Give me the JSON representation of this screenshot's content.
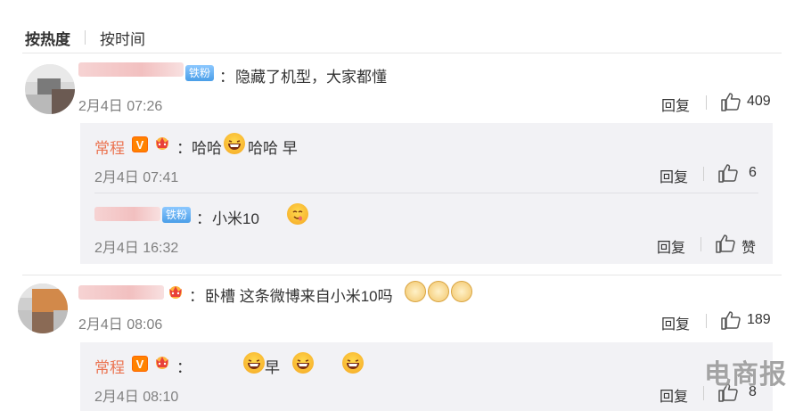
{
  "sort": {
    "hot": "按热度",
    "time": "按时间"
  },
  "badges": {
    "fan": "铁粉",
    "vip": "V"
  },
  "watermark": "电商报",
  "comments": [
    {
      "colon": "：",
      "text": "隐藏了机型，大家都懂",
      "time": "2月4日 07:26",
      "reply_label": "回复",
      "likes": "409",
      "replies": [
        {
          "user": "常程",
          "text_a": "：哈哈",
          "text_b": "哈哈 早",
          "time": "2月4日 07:41",
          "reply_label": "回复",
          "likes": "6"
        },
        {
          "colon": "：",
          "text": "小米10",
          "time": "2月4日 16:32",
          "reply_label": "回复",
          "likes": "赞"
        }
      ]
    },
    {
      "colon": "：",
      "text": "卧槽 这条微博来自小米10吗",
      "time": "2月4日 08:06",
      "reply_label": "回复",
      "likes": "189",
      "replies": [
        {
          "user": "常程",
          "colon": "：",
          "text_b": "早",
          "time": "2月4日 08:10",
          "reply_label": "回复",
          "likes": "8"
        }
      ]
    }
  ]
}
